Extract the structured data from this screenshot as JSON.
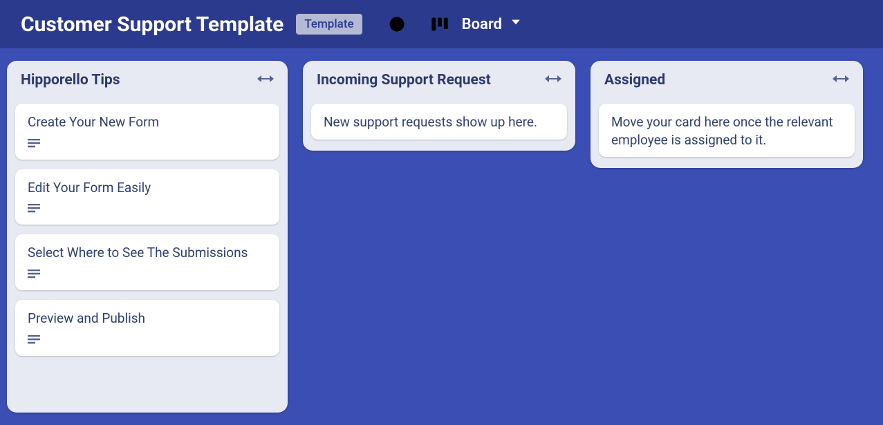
{
  "header": {
    "title": "Customer Support Template",
    "badge": "Template",
    "view_label": "Board"
  },
  "lists": [
    {
      "title": "Hipporello Tips",
      "cards": [
        {
          "title": "Create Your New Form",
          "has_desc": true
        },
        {
          "title": "Edit Your Form Easily",
          "has_desc": true
        },
        {
          "title": "Select Where to See The Submissions",
          "has_desc": true
        },
        {
          "title": "Preview and Publish",
          "has_desc": true
        }
      ]
    },
    {
      "title": "Incoming Support Request",
      "cards": [
        {
          "title": "New support requests show up here.",
          "has_desc": false
        }
      ]
    },
    {
      "title": "Assigned",
      "cards": [
        {
          "title": "Move your card here once the relevant employee is assigned to it.",
          "has_desc": false
        }
      ]
    }
  ]
}
